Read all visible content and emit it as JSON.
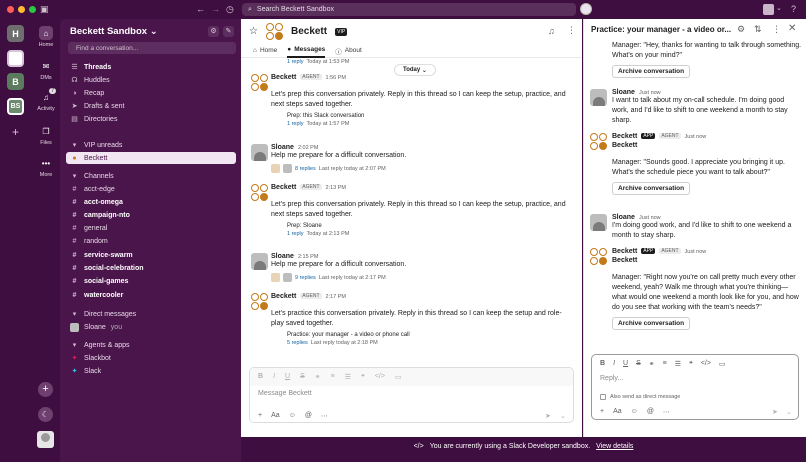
{
  "window": {
    "search_placeholder": "Search Beckett Sandbox"
  },
  "rail": {
    "workspaces": [
      "H",
      "B",
      "BS"
    ],
    "nav": [
      {
        "label": "Home"
      },
      {
        "label": "DMs"
      },
      {
        "label": "Activity",
        "badge": "7"
      },
      {
        "label": "Files"
      },
      {
        "label": "More"
      }
    ]
  },
  "sidebar": {
    "title": "Beckett Sandbox",
    "find_placeholder": "Find a conversation...",
    "top": [
      {
        "label": "Threads"
      },
      {
        "label": "Huddles"
      },
      {
        "label": "Recap"
      },
      {
        "label": "Drafts & sent"
      },
      {
        "label": "Directories"
      }
    ],
    "vip_header": "VIP unreads",
    "vip_item": "Beckett",
    "channels_header": "Channels",
    "channels": [
      {
        "label": "acct-edge",
        "bold": false
      },
      {
        "label": "acct-omega",
        "bold": true
      },
      {
        "label": "campaign-nto",
        "bold": true
      },
      {
        "label": "general",
        "bold": false
      },
      {
        "label": "random",
        "bold": false
      },
      {
        "label": "service-swarm",
        "bold": true
      },
      {
        "label": "social-celebration",
        "bold": true
      },
      {
        "label": "social-games",
        "bold": true
      },
      {
        "label": "watercooler",
        "bold": true
      }
    ],
    "dm_header": "Direct messages",
    "dm_item": "Sloane",
    "dm_you": "you",
    "apps_header": "Agents & apps",
    "apps": [
      "Slackbot",
      "Slack"
    ]
  },
  "channel": {
    "name": "Beckett",
    "vip": "VIP",
    "tabs": [
      "Home",
      "Messages",
      "About"
    ],
    "date_pill": "Today",
    "top_reply": "1 reply",
    "top_reply_time": "Today at 1:53 PM",
    "messages": [
      {
        "author": "Beckett",
        "tag": "AGENT",
        "time": "1:56 PM",
        "text": "Let's prep this conversation privately. Reply in this thread so I can keep the setup, practice, and next steps saved together.",
        "prep": "Prep: this Slack conversation",
        "replies": "1 reply",
        "reply_time": "Today at 1:57 PM"
      },
      {
        "author": "Sloane",
        "tag": "",
        "time": "2:02 PM",
        "text": "Help me prepare for a difficult conversation.",
        "prep": "",
        "replies": "8 replies",
        "reply_time": "Last reply today at 2:07 PM"
      },
      {
        "author": "Beckett",
        "tag": "AGENT",
        "time": "2:13 PM",
        "text": "Let's prep this conversation privately. Reply in this thread so I can keep the setup, practice, and next steps saved together.",
        "prep": "Prep: Sloane",
        "replies": "1 reply",
        "reply_time": "Today at 2:13 PM"
      },
      {
        "author": "Sloane",
        "tag": "",
        "time": "2:15 PM",
        "text": "Help me prepare for a difficult conversation.",
        "prep": "",
        "replies": "9 replies",
        "reply_time": "Last reply today at 2:17 PM"
      },
      {
        "author": "Beckett",
        "tag": "AGENT",
        "time": "2:17 PM",
        "text": "Let's practice this conversation privately. Reply in this thread so I can keep the setup and role-play saved together.",
        "prep": "Practice: your manager - a video or phone call",
        "replies": "5 replies",
        "reply_time": "Last reply today at 2:18 PM"
      }
    ],
    "composer_placeholder": "Message Beckett"
  },
  "thread": {
    "title": "Practice: your manager - a video or...",
    "items": [
      {
        "author": "",
        "time": "",
        "text": "Manager: \"Hey, thanks for wanting to talk through something. What's on your mind?\"",
        "button": "Archive conversation"
      },
      {
        "author": "Sloane",
        "time": "Just now",
        "text": "I want to talk about my on-call schedule. I'm doing good work, and I'd like to shift to one weekend a month to stay sharp.",
        "button": ""
      },
      {
        "author": "Beckett",
        "time": "Just now",
        "app": "APP",
        "tag": "AGENT",
        "sub": "Beckett",
        "text": "Manager: \"Sounds good. I appreciate you bringing it up. What's the schedule piece you want to talk about?\"",
        "button": "Archive conversation"
      },
      {
        "author": "Sloane",
        "time": "Just now",
        "text": "I'm doing good work, and I'd like to shift to one weekend a month to stay sharp.",
        "button": ""
      },
      {
        "author": "Beckett",
        "time": "Just now",
        "app": "APP",
        "tag": "AGENT",
        "sub": "Beckett",
        "text": "Manager: \"Right now you're on call pretty much every other weekend, yeah? Walk me through what you're thinking—what would one weekend a month look like for you, and how do you see that working with the team's needs?\"",
        "button": "Archive conversation"
      }
    ],
    "reply_placeholder": "Reply...",
    "also_send": "Also send as direct message"
  },
  "banner": {
    "text": "You are currently using a Slack Developer sandbox.",
    "link": "View details"
  },
  "colors": {
    "aubergine": "#3f0e40",
    "sidebar": "#4a154b",
    "link": "#1264a3",
    "agent_orange": "#c27a1a"
  }
}
